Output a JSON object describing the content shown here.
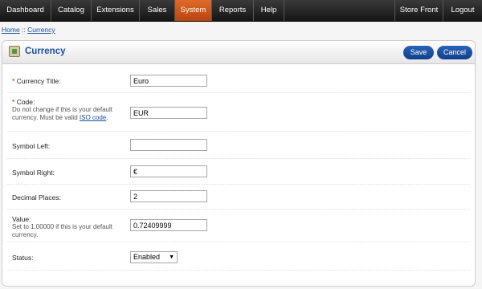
{
  "nav": {
    "items": [
      "Dashboard",
      "Catalog",
      "Extensions",
      "Sales",
      "System",
      "Reports",
      "Help"
    ],
    "right": [
      "Store Front",
      "Logout"
    ],
    "active": "System"
  },
  "breadcrumb": {
    "home": "Home",
    "separator": "::",
    "current": "Currency"
  },
  "panel": {
    "title": "Currency",
    "save": "Save",
    "cancel": "Cancel"
  },
  "form": {
    "required_mark": "*",
    "currency_title": {
      "label": "Currency Title:",
      "value": "Euro"
    },
    "code": {
      "label": "Code:",
      "help": "Do not change if this is your default currency. Must be valid",
      "help_link": "ISO code",
      "help_end": ".",
      "value": "EUR"
    },
    "symbol_left": {
      "label": "Symbol Left:",
      "value": ""
    },
    "symbol_right": {
      "label": "Symbol Right:",
      "value": "€"
    },
    "decimal_places": {
      "label": "Decimal Places:",
      "value": "2"
    },
    "value": {
      "label": "Value:",
      "help": "Set to 1.00000 if this is your default currency.",
      "value": "0.72409999"
    },
    "status": {
      "label": "Status:",
      "selected": "Enabled",
      "caret": "▼"
    }
  }
}
